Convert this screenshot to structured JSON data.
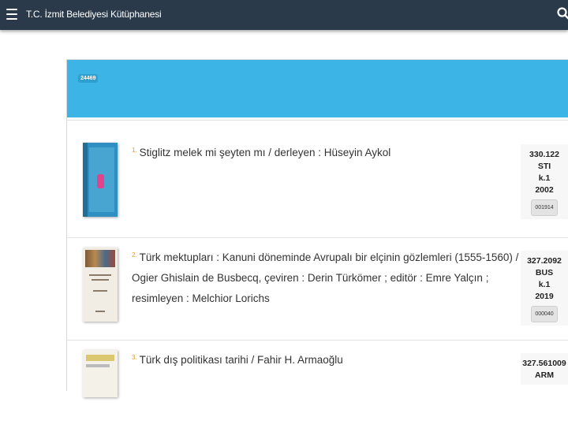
{
  "header": {
    "title": "T.C. İzmit Belediyesi Kütüphanesi"
  },
  "results_header": {
    "count": "24469"
  },
  "results": [
    {
      "num": "1.",
      "title": "Stiglitz melek mi şeyten mı / derleyen : Hüseyin Aykol",
      "callno": [
        "330.122",
        "STI",
        "k.1",
        "2002"
      ],
      "barcode": "001914"
    },
    {
      "num": "2.",
      "title": "Türk mektupları : Kanuni döneminde Avrupalı bir elçinin gözlemleri (1555-1560) / Ogier Ghislain de Busbecq, çeviren : Derin Türkömer ; editör : Emre Yalçın ; resimleyen : Melchior Lorichs",
      "callno": [
        "327.2092",
        "BUS",
        "k.1",
        "2019"
      ],
      "barcode": "000040"
    },
    {
      "num": "3.",
      "title": "Türk dış politikası tarihi / Fahir H. Armaoğlu",
      "callno": [
        "327.561009",
        "ARM"
      ],
      "barcode": ""
    }
  ]
}
